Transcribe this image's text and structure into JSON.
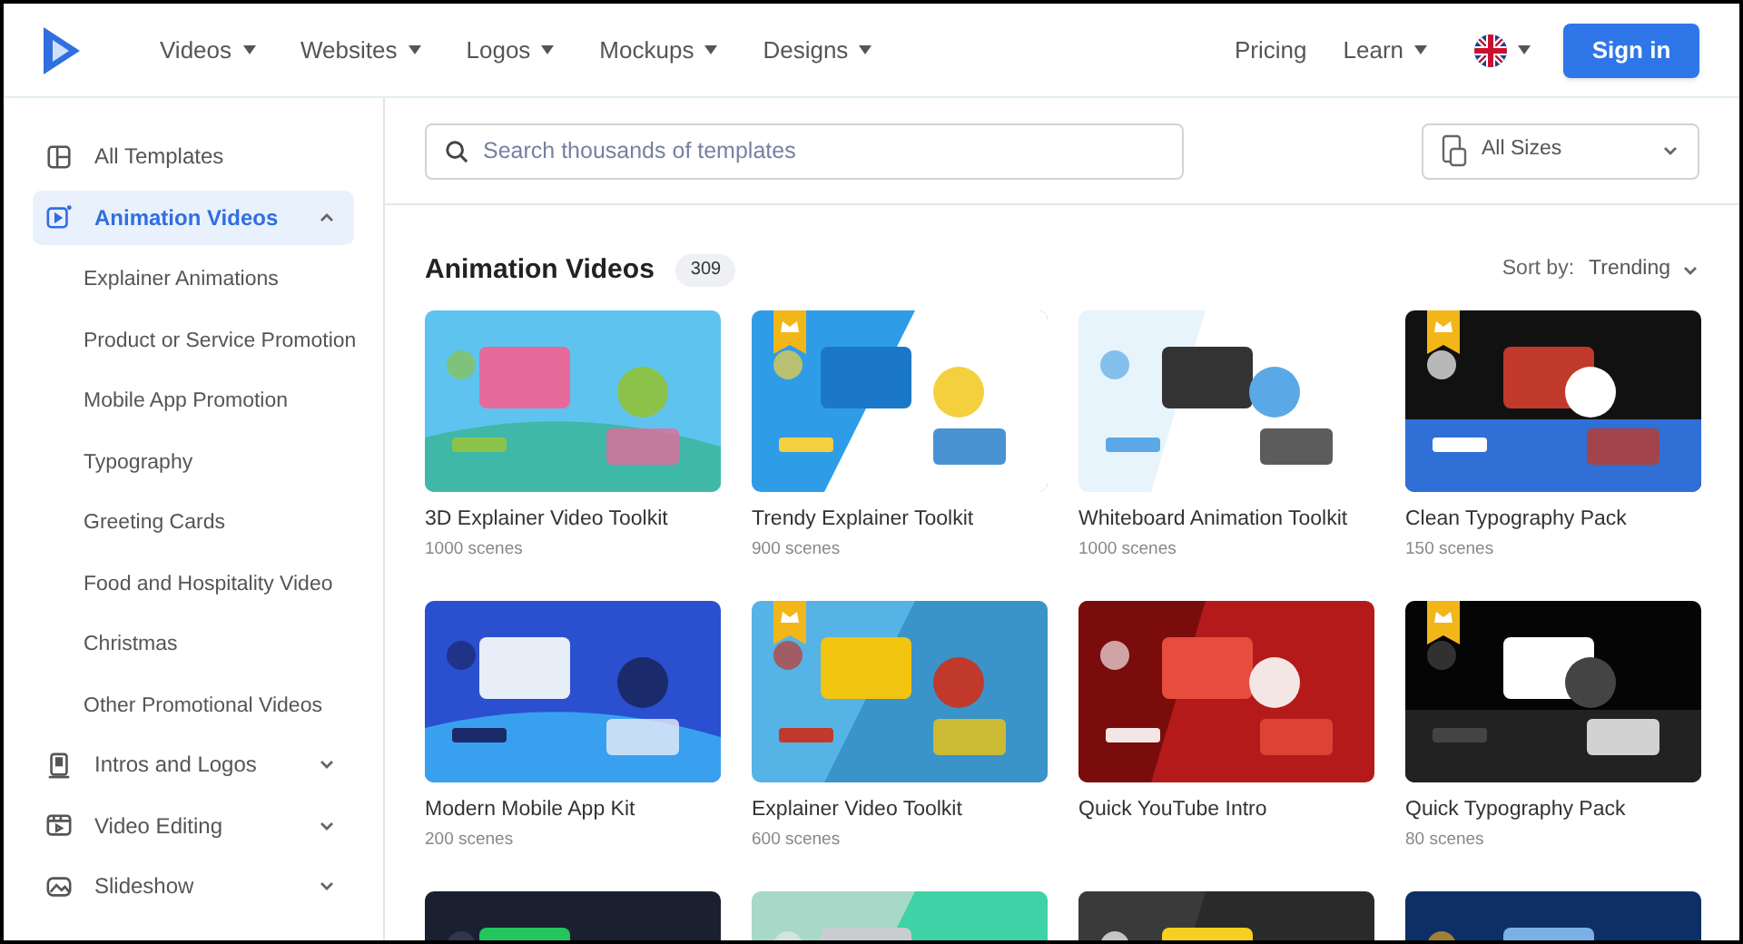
{
  "nav": {
    "menus": [
      {
        "label": "Videos"
      },
      {
        "label": "Websites"
      },
      {
        "label": "Logos"
      },
      {
        "label": "Mockups"
      },
      {
        "label": "Designs"
      }
    ],
    "pricing": "Pricing",
    "learn": "Learn",
    "sign_in": "Sign in"
  },
  "sidebar": {
    "items": [
      {
        "label": "All Templates",
        "selected": false
      },
      {
        "label": "Animation Videos",
        "selected": true,
        "expanded": true,
        "children": [
          {
            "label": "Explainer Animations"
          },
          {
            "label": "Product or Service Promotion"
          },
          {
            "label": "Mobile App Promotion"
          },
          {
            "label": "Typography"
          },
          {
            "label": "Greeting Cards"
          },
          {
            "label": "Food and Hospitality Video"
          },
          {
            "label": "Christmas"
          },
          {
            "label": "Other Promotional Videos"
          }
        ]
      },
      {
        "label": "Intros and Logos",
        "selected": false,
        "expanded": false
      },
      {
        "label": "Video Editing",
        "selected": false,
        "expanded": false
      },
      {
        "label": "Slideshow",
        "selected": false,
        "expanded": false
      }
    ]
  },
  "search": {
    "placeholder": "Search thousands of templates"
  },
  "size_filter": {
    "value": "All Sizes"
  },
  "section": {
    "title": "Animation Videos",
    "count": "309",
    "sort_label": "Sort by:",
    "sort_value": "Trending"
  },
  "templates": [
    {
      "kind": "template",
      "title": "3D Explainer Video Toolkit",
      "scenes": "1000 scenes",
      "premium": false
    },
    {
      "kind": "template",
      "title": "Trendy Explainer Toolkit",
      "scenes": "900 scenes",
      "premium": true
    },
    {
      "kind": "template",
      "title": "Whiteboard Animation Toolkit",
      "scenes": "1000 scenes",
      "premium": false
    },
    {
      "kind": "template",
      "title": "Clean Typography Pack",
      "scenes": "150 scenes",
      "premium": true
    },
    {
      "kind": "template",
      "title": "Modern Mobile App Kit",
      "scenes": "200 scenes",
      "premium": false
    },
    {
      "kind": "template",
      "title": "Explainer Video Toolkit",
      "scenes": "600 scenes",
      "premium": true
    },
    {
      "kind": "template",
      "title": "Quick YouTube Intro",
      "premium": false
    },
    {
      "kind": "template",
      "title": "Quick Typography Pack",
      "scenes": "80 scenes",
      "premium": true
    },
    {
      "kind": "picture"
    },
    {
      "kind": "picture"
    },
    {
      "kind": "picture"
    },
    {
      "kind": "picture"
    }
  ]
}
